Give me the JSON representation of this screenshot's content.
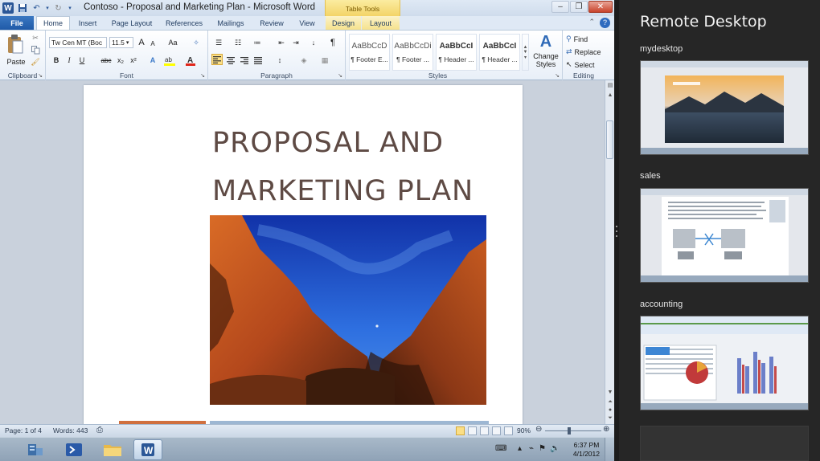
{
  "window": {
    "title": "Contoso - Proposal and Marketing Plan - Microsoft Word",
    "context_tab_group": "Table Tools"
  },
  "tabs": {
    "file": "File",
    "items": [
      "Home",
      "Insert",
      "Page Layout",
      "References",
      "Mailings",
      "Review",
      "View",
      "Design",
      "Layout"
    ]
  },
  "ribbon": {
    "clipboard": {
      "paste": "Paste",
      "label": "Clipboard"
    },
    "font": {
      "name": "Tw Cen MT (Boc",
      "size": "11.5",
      "grow": "A",
      "shrink": "A",
      "change_case": "Aa",
      "bold": "B",
      "italic": "I",
      "underline": "U",
      "strike": "abc",
      "subscript": "x₂",
      "superscript": "x²",
      "label": "Font"
    },
    "paragraph": {
      "pilcrow": "¶",
      "sort": "↓",
      "label": "Paragraph"
    },
    "styles": {
      "items": [
        {
          "sample": "AaBbCcD",
          "name": "¶ Footer E..."
        },
        {
          "sample": "AaBbCcDi",
          "name": "¶ Footer ..."
        },
        {
          "sample": "AaBbCcI",
          "name": "¶ Header ..."
        },
        {
          "sample": "AaBbCcI",
          "name": "¶ Header ..."
        }
      ],
      "change_styles_line1": "Change",
      "change_styles_line2": "Styles",
      "label": "Styles"
    },
    "editing": {
      "find": "Find",
      "replace": "Replace",
      "select": "Select",
      "label": "Editing"
    }
  },
  "document": {
    "title_line1": "PROPOSAL AND",
    "title_line2": "MARKETING PLAN"
  },
  "statusbar": {
    "page": "Page: 1 of 4",
    "words": "Words: 443",
    "zoom": "90%",
    "zoom_level": 0.9
  },
  "taskbar": {
    "time": "6:37 PM",
    "date": "4/1/2012"
  },
  "remote_desktop": {
    "title": "Remote Desktop",
    "sessions": [
      {
        "name": "mydesktop"
      },
      {
        "name": "sales"
      },
      {
        "name": "accounting"
      }
    ]
  },
  "colors": {
    "word_blue": "#2b5797",
    "doc_title": "#5e4a44",
    "panel_bg": "#262626",
    "accent_orange": "#d0703f",
    "accent_blue": "#9db7d3"
  }
}
